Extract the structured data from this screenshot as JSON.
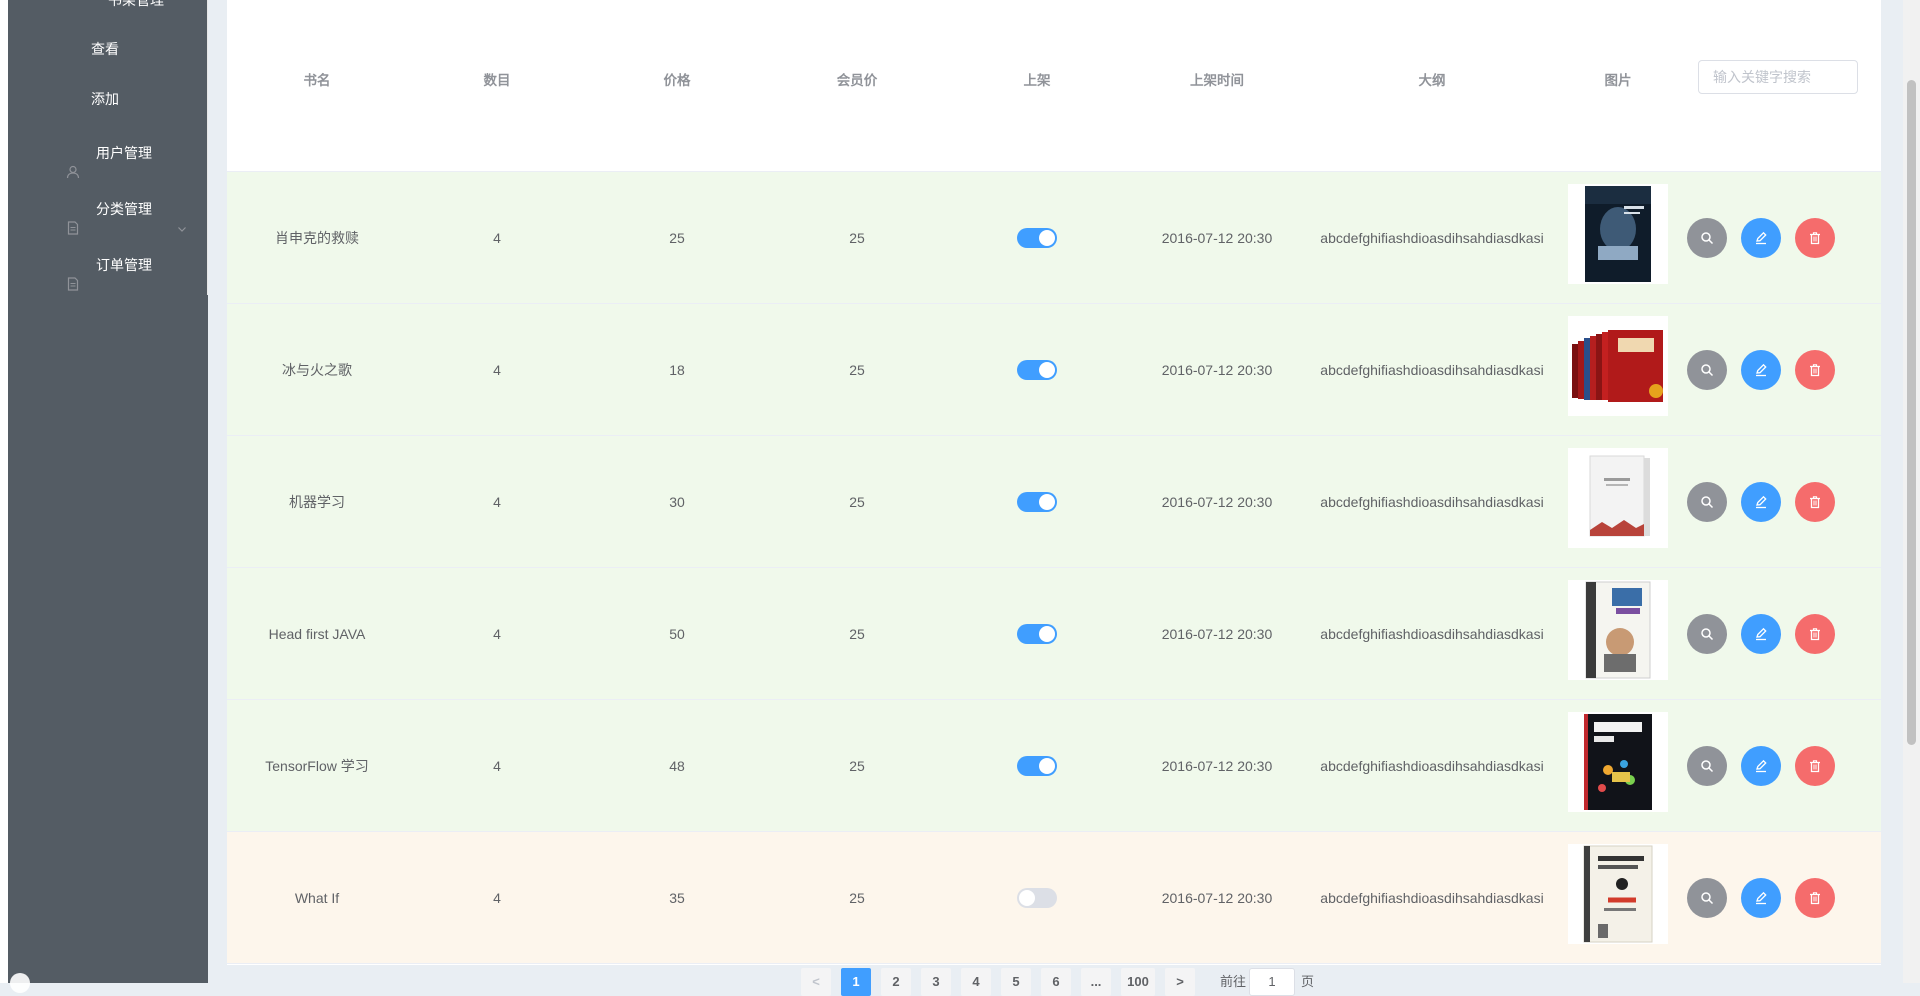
{
  "sidebar": {
    "cut_group_label": "书架管理",
    "sub_items": [
      {
        "label": "查看"
      },
      {
        "label": "添加"
      }
    ],
    "items": [
      {
        "label": "用户管理",
        "icon": "user-icon"
      },
      {
        "label": "分类管理",
        "icon": "document-icon",
        "has_submenu": true
      },
      {
        "label": "订单管理",
        "icon": "document-icon"
      }
    ]
  },
  "table": {
    "headers": [
      "书名",
      "数目",
      "价格",
      "会员价",
      "上架",
      "上架时间",
      "大纲",
      "图片"
    ],
    "search_placeholder": "输入关键字搜索",
    "rows": [
      {
        "name": "肖申克的救赎",
        "count": "4",
        "price": "25",
        "member_price": "25",
        "listed": true,
        "time": "2016-07-12 20:30",
        "outline": "abcdefghifiashdioasdihsahdiasdkasi",
        "cover": "dark-blue-cover"
      },
      {
        "name": "冰与火之歌",
        "count": "4",
        "price": "18",
        "member_price": "25",
        "listed": true,
        "time": "2016-07-12 20:30",
        "outline": "abcdefghifiashdioasdihsahdiasdkasi",
        "cover": "red-boxset-cover"
      },
      {
        "name": "机器学习",
        "count": "4",
        "price": "30",
        "member_price": "25",
        "listed": true,
        "time": "2016-07-12 20:30",
        "outline": "abcdefghifiashdioasdihsahdiasdkasi",
        "cover": "white-cover"
      },
      {
        "name": "Head first JAVA",
        "count": "4",
        "price": "50",
        "member_price": "25",
        "listed": true,
        "time": "2016-07-12 20:30",
        "outline": "abcdefghifiashdioasdihsahdiasdkasi",
        "cover": "head-first-cover"
      },
      {
        "name": "TensorFlow 学习",
        "count": "4",
        "price": "48",
        "member_price": "25",
        "listed": true,
        "time": "2016-07-12 20:30",
        "outline": "abcdefghifiashdioasdihsahdiasdkasi",
        "cover": "tensorflow-cover"
      },
      {
        "name": "What If",
        "count": "4",
        "price": "35",
        "member_price": "25",
        "listed": false,
        "time": "2016-07-12 20:30",
        "outline": "abcdefghifiashdioasdihsahdiasdkasi",
        "cover": "what-if-cover"
      }
    ],
    "row_actions": [
      {
        "icon": "search-icon"
      },
      {
        "icon": "edit-icon"
      },
      {
        "icon": "delete-icon"
      }
    ]
  },
  "pagination": {
    "prev": "<",
    "pages": [
      "1",
      "2",
      "3",
      "4",
      "5",
      "6",
      "...",
      "100"
    ],
    "current": "1",
    "next": ">",
    "goto_label": "前往",
    "goto_value": "1",
    "page_unit": "页"
  },
  "colors": {
    "sidebar_bg": "#545c64",
    "primary": "#409eff",
    "danger": "#f56c6c",
    "info": "#909399",
    "success_row": "#f0f9eb",
    "warning_row": "#fdf6ec"
  }
}
